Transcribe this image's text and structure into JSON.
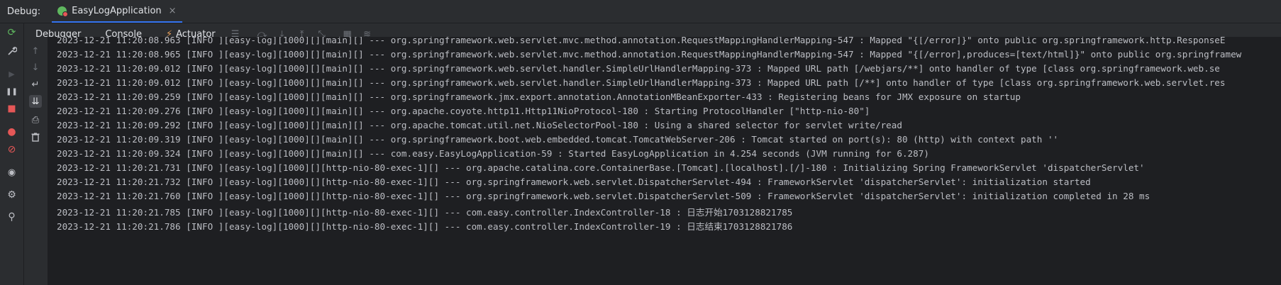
{
  "topbar": {
    "debug_label": "Debug:",
    "tab_label": "EasyLogApplication",
    "tab_close": "×"
  },
  "toolbar": {
    "debugger_label": "Debugger",
    "console_label": "Console",
    "actuator_label": "Actuator"
  },
  "icons": {
    "rerun": "⟳",
    "wrench": "🔧",
    "resume": "▶",
    "pause": "❚❚",
    "stop": "■",
    "breakpoints": "●",
    "mute": "⊘",
    "camera": "◉",
    "settings": "⚙",
    "pin": "⚲",
    "up": "↑",
    "down": "↓",
    "wrap": "↵",
    "scroll_end": "⇊",
    "print": "⎙",
    "trash": "🗑"
  },
  "colors": {
    "accent": "#3574f0",
    "rerun": "#5fb85f",
    "stop": "#e55757"
  },
  "log_lines": [
    "2023-12-21 11:20:08.963 [INFO ][easy-log][1000][][main][] --- org.springframework.web.servlet.mvc.method.annotation.RequestMappingHandlerMapping-547 : Mapped \"{[/error]}\" onto public org.springframework.http.ResponseE",
    "2023-12-21 11:20:08.965 [INFO ][easy-log][1000][][main][] --- org.springframework.web.servlet.mvc.method.annotation.RequestMappingHandlerMapping-547 : Mapped \"{[/error],produces=[text/html]}\" onto public org.springframew",
    "2023-12-21 11:20:09.012 [INFO ][easy-log][1000][][main][] --- org.springframework.web.servlet.handler.SimpleUrlHandlerMapping-373 : Mapped URL path [/webjars/**] onto handler of type [class org.springframework.web.se",
    "2023-12-21 11:20:09.012 [INFO ][easy-log][1000][][main][] --- org.springframework.web.servlet.handler.SimpleUrlHandlerMapping-373 : Mapped URL path [/**] onto handler of type [class org.springframework.web.servlet.res",
    "2023-12-21 11:20:09.259 [INFO ][easy-log][1000][][main][] --- org.springframework.jmx.export.annotation.AnnotationMBeanExporter-433 : Registering beans for JMX exposure on startup",
    "2023-12-21 11:20:09.276 [INFO ][easy-log][1000][][main][] --- org.apache.coyote.http11.Http11NioProtocol-180 : Starting ProtocolHandler [\"http-nio-80\"]",
    "2023-12-21 11:20:09.292 [INFO ][easy-log][1000][][main][] --- org.apache.tomcat.util.net.NioSelectorPool-180 : Using a shared selector for servlet write/read",
    "2023-12-21 11:20:09.319 [INFO ][easy-log][1000][][main][] --- org.springframework.boot.web.embedded.tomcat.TomcatWebServer-206 : Tomcat started on port(s): 80 (http) with context path ''",
    "2023-12-21 11:20:09.324 [INFO ][easy-log][1000][][main][] --- com.easy.EasyLogApplication-59 : Started EasyLogApplication in 4.254 seconds (JVM running for 6.287)",
    "2023-12-21 11:20:21.731 [INFO ][easy-log][1000][][http-nio-80-exec-1][] --- org.apache.catalina.core.ContainerBase.[Tomcat].[localhost].[/]-180 : Initializing Spring FrameworkServlet 'dispatcherServlet'",
    "2023-12-21 11:20:21.732 [INFO ][easy-log][1000][][http-nio-80-exec-1][] --- org.springframework.web.servlet.DispatcherServlet-494 : FrameworkServlet 'dispatcherServlet': initialization started",
    "2023-12-21 11:20:21.760 [INFO ][easy-log][1000][][http-nio-80-exec-1][] --- org.springframework.web.servlet.DispatcherServlet-509 : FrameworkServlet 'dispatcherServlet': initialization completed in 28 ms",
    "2023-12-21 11:20:21.785 [INFO ][easy-log][1000][][http-nio-80-exec-1][] --- com.easy.controller.IndexController-18 : 日志开始1703128821785",
    "2023-12-21 11:20:21.786 [INFO ][easy-log][1000][][http-nio-80-exec-1][] --- com.easy.controller.IndexController-19 : 日志结束1703128821786"
  ]
}
